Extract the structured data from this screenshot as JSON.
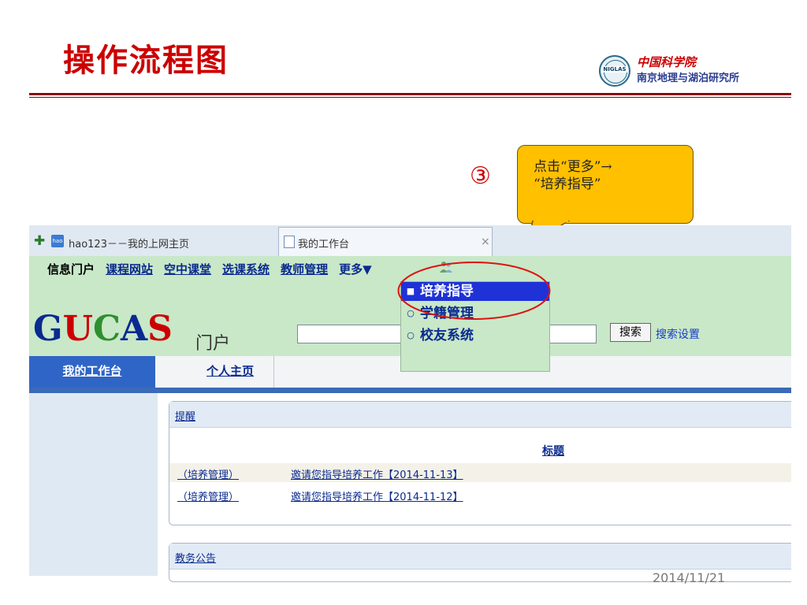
{
  "slide": {
    "title": "操作流程图",
    "logo_line1": "中国科学院",
    "logo_line2": "南京地理与湖泊研究所",
    "logo_badge": "NIGLAS",
    "step_number": "③",
    "callout_line1": "点击“更多”→",
    "callout_line2": "“培养指导”",
    "date": "2014/11/21",
    "title_color": "#cc0000",
    "callout_color": "#ffc000"
  },
  "browser": {
    "tab1_label": "hao123－－我的上网主页",
    "tab2_label": "我的工作台",
    "tab2_close": "×"
  },
  "portal": {
    "nav_label": "信息门户",
    "nav_links": [
      "课程网站",
      "空中课堂",
      "选课系统",
      "教师管理"
    ],
    "more_label": "更多▼",
    "brand_letters": [
      "G",
      "U",
      "C",
      "A",
      "S"
    ],
    "brand_sub": "门户",
    "search_value": "",
    "search_button": "搜索",
    "search_settings": "搜索设置",
    "tabs": [
      "我的工作台",
      "个人主页"
    ]
  },
  "dropdown": {
    "items": [
      {
        "label": "培养指导",
        "bullet": "■"
      },
      {
        "label": "学籍管理",
        "bullet": "○"
      },
      {
        "label": "校友系统",
        "bullet": "○"
      }
    ]
  },
  "reminder": {
    "panel_title": "提醒",
    "column_title": "标题",
    "rows": [
      {
        "category": "（培养管理）",
        "title": "邀请您指导培养工作【2014-11-13】"
      },
      {
        "category": "（培养管理）",
        "title": "邀请您指导培养工作【2014-11-12】"
      }
    ]
  },
  "notice": {
    "panel_title": "教务公告"
  }
}
